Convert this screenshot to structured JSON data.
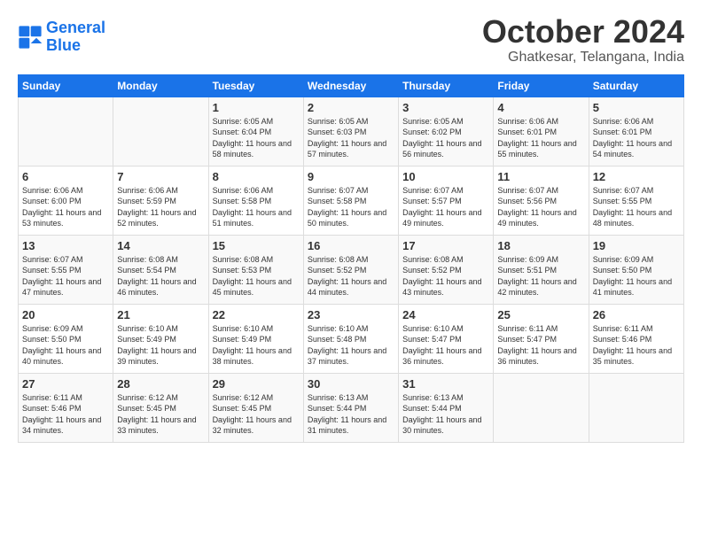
{
  "logo": {
    "line1": "General",
    "line2": "Blue"
  },
  "title": "October 2024",
  "location": "Ghatkesar, Telangana, India",
  "header_colors": {
    "bg": "#1a73e8"
  },
  "days_of_week": [
    "Sunday",
    "Monday",
    "Tuesday",
    "Wednesday",
    "Thursday",
    "Friday",
    "Saturday"
  ],
  "weeks": [
    [
      {
        "day": "",
        "sunrise": "",
        "sunset": "",
        "daylight": ""
      },
      {
        "day": "",
        "sunrise": "",
        "sunset": "",
        "daylight": ""
      },
      {
        "day": "1",
        "sunrise": "Sunrise: 6:05 AM",
        "sunset": "Sunset: 6:04 PM",
        "daylight": "Daylight: 11 hours and 58 minutes."
      },
      {
        "day": "2",
        "sunrise": "Sunrise: 6:05 AM",
        "sunset": "Sunset: 6:03 PM",
        "daylight": "Daylight: 11 hours and 57 minutes."
      },
      {
        "day": "3",
        "sunrise": "Sunrise: 6:05 AM",
        "sunset": "Sunset: 6:02 PM",
        "daylight": "Daylight: 11 hours and 56 minutes."
      },
      {
        "day": "4",
        "sunrise": "Sunrise: 6:06 AM",
        "sunset": "Sunset: 6:01 PM",
        "daylight": "Daylight: 11 hours and 55 minutes."
      },
      {
        "day": "5",
        "sunrise": "Sunrise: 6:06 AM",
        "sunset": "Sunset: 6:01 PM",
        "daylight": "Daylight: 11 hours and 54 minutes."
      }
    ],
    [
      {
        "day": "6",
        "sunrise": "Sunrise: 6:06 AM",
        "sunset": "Sunset: 6:00 PM",
        "daylight": "Daylight: 11 hours and 53 minutes."
      },
      {
        "day": "7",
        "sunrise": "Sunrise: 6:06 AM",
        "sunset": "Sunset: 5:59 PM",
        "daylight": "Daylight: 11 hours and 52 minutes."
      },
      {
        "day": "8",
        "sunrise": "Sunrise: 6:06 AM",
        "sunset": "Sunset: 5:58 PM",
        "daylight": "Daylight: 11 hours and 51 minutes."
      },
      {
        "day": "9",
        "sunrise": "Sunrise: 6:07 AM",
        "sunset": "Sunset: 5:58 PM",
        "daylight": "Daylight: 11 hours and 50 minutes."
      },
      {
        "day": "10",
        "sunrise": "Sunrise: 6:07 AM",
        "sunset": "Sunset: 5:57 PM",
        "daylight": "Daylight: 11 hours and 49 minutes."
      },
      {
        "day": "11",
        "sunrise": "Sunrise: 6:07 AM",
        "sunset": "Sunset: 5:56 PM",
        "daylight": "Daylight: 11 hours and 49 minutes."
      },
      {
        "day": "12",
        "sunrise": "Sunrise: 6:07 AM",
        "sunset": "Sunset: 5:55 PM",
        "daylight": "Daylight: 11 hours and 48 minutes."
      }
    ],
    [
      {
        "day": "13",
        "sunrise": "Sunrise: 6:07 AM",
        "sunset": "Sunset: 5:55 PM",
        "daylight": "Daylight: 11 hours and 47 minutes."
      },
      {
        "day": "14",
        "sunrise": "Sunrise: 6:08 AM",
        "sunset": "Sunset: 5:54 PM",
        "daylight": "Daylight: 11 hours and 46 minutes."
      },
      {
        "day": "15",
        "sunrise": "Sunrise: 6:08 AM",
        "sunset": "Sunset: 5:53 PM",
        "daylight": "Daylight: 11 hours and 45 minutes."
      },
      {
        "day": "16",
        "sunrise": "Sunrise: 6:08 AM",
        "sunset": "Sunset: 5:52 PM",
        "daylight": "Daylight: 11 hours and 44 minutes."
      },
      {
        "day": "17",
        "sunrise": "Sunrise: 6:08 AM",
        "sunset": "Sunset: 5:52 PM",
        "daylight": "Daylight: 11 hours and 43 minutes."
      },
      {
        "day": "18",
        "sunrise": "Sunrise: 6:09 AM",
        "sunset": "Sunset: 5:51 PM",
        "daylight": "Daylight: 11 hours and 42 minutes."
      },
      {
        "day": "19",
        "sunrise": "Sunrise: 6:09 AM",
        "sunset": "Sunset: 5:50 PM",
        "daylight": "Daylight: 11 hours and 41 minutes."
      }
    ],
    [
      {
        "day": "20",
        "sunrise": "Sunrise: 6:09 AM",
        "sunset": "Sunset: 5:50 PM",
        "daylight": "Daylight: 11 hours and 40 minutes."
      },
      {
        "day": "21",
        "sunrise": "Sunrise: 6:10 AM",
        "sunset": "Sunset: 5:49 PM",
        "daylight": "Daylight: 11 hours and 39 minutes."
      },
      {
        "day": "22",
        "sunrise": "Sunrise: 6:10 AM",
        "sunset": "Sunset: 5:49 PM",
        "daylight": "Daylight: 11 hours and 38 minutes."
      },
      {
        "day": "23",
        "sunrise": "Sunrise: 6:10 AM",
        "sunset": "Sunset: 5:48 PM",
        "daylight": "Daylight: 11 hours and 37 minutes."
      },
      {
        "day": "24",
        "sunrise": "Sunrise: 6:10 AM",
        "sunset": "Sunset: 5:47 PM",
        "daylight": "Daylight: 11 hours and 36 minutes."
      },
      {
        "day": "25",
        "sunrise": "Sunrise: 6:11 AM",
        "sunset": "Sunset: 5:47 PM",
        "daylight": "Daylight: 11 hours and 36 minutes."
      },
      {
        "day": "26",
        "sunrise": "Sunrise: 6:11 AM",
        "sunset": "Sunset: 5:46 PM",
        "daylight": "Daylight: 11 hours and 35 minutes."
      }
    ],
    [
      {
        "day": "27",
        "sunrise": "Sunrise: 6:11 AM",
        "sunset": "Sunset: 5:46 PM",
        "daylight": "Daylight: 11 hours and 34 minutes."
      },
      {
        "day": "28",
        "sunrise": "Sunrise: 6:12 AM",
        "sunset": "Sunset: 5:45 PM",
        "daylight": "Daylight: 11 hours and 33 minutes."
      },
      {
        "day": "29",
        "sunrise": "Sunrise: 6:12 AM",
        "sunset": "Sunset: 5:45 PM",
        "daylight": "Daylight: 11 hours and 32 minutes."
      },
      {
        "day": "30",
        "sunrise": "Sunrise: 6:13 AM",
        "sunset": "Sunset: 5:44 PM",
        "daylight": "Daylight: 11 hours and 31 minutes."
      },
      {
        "day": "31",
        "sunrise": "Sunrise: 6:13 AM",
        "sunset": "Sunset: 5:44 PM",
        "daylight": "Daylight: 11 hours and 30 minutes."
      },
      {
        "day": "",
        "sunrise": "",
        "sunset": "",
        "daylight": ""
      },
      {
        "day": "",
        "sunrise": "",
        "sunset": "",
        "daylight": ""
      }
    ]
  ]
}
